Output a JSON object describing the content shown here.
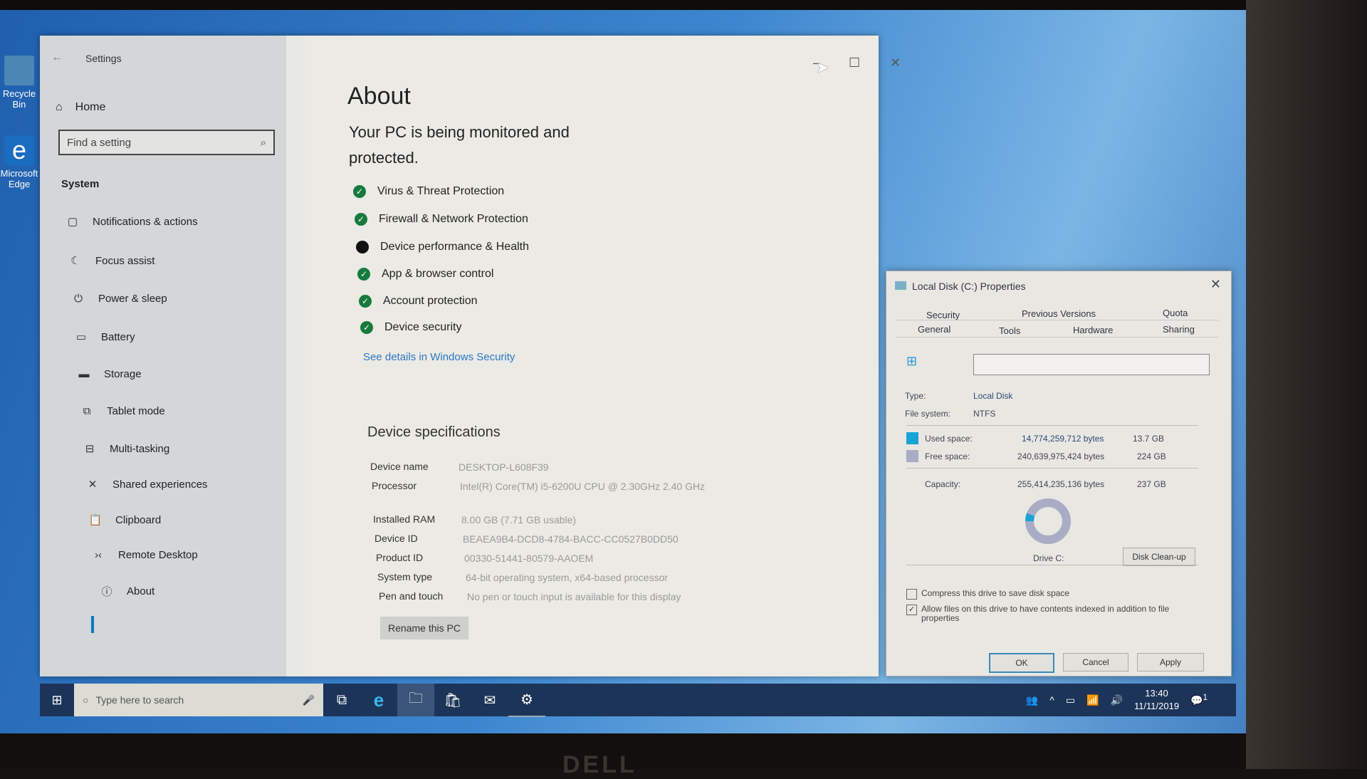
{
  "desktop": {
    "icons": [
      {
        "label": "Recycle Bin",
        "icon": "recycle-bin-icon"
      },
      {
        "label": "Microsoft Edge",
        "icon": "edge-icon"
      }
    ],
    "monitor_brand": "DELL"
  },
  "settings": {
    "window_title": "Settings",
    "back_icon": "back-arrow-icon",
    "window_controls": {
      "minimize": "–",
      "maximize": "☐",
      "close": "✕"
    },
    "home_label": "Home",
    "search_placeholder": "Find a setting",
    "section_label": "System",
    "nav_items": [
      {
        "label": "Notifications & actions",
        "icon": "notification-icon",
        "glyph": "▢"
      },
      {
        "label": "Focus assist",
        "icon": "moon-icon",
        "glyph": "☾"
      },
      {
        "label": "Power & sleep",
        "icon": "power-icon",
        "glyph": "⏻"
      },
      {
        "label": "Battery",
        "icon": "battery-icon",
        "glyph": "▭"
      },
      {
        "label": "Storage",
        "icon": "storage-icon",
        "glyph": "▬"
      },
      {
        "label": "Tablet mode",
        "icon": "tablet-icon",
        "glyph": "⧉"
      },
      {
        "label": "Multi-tasking",
        "icon": "multitasking-icon",
        "glyph": "⊟"
      },
      {
        "label": "Shared experiences",
        "icon": "shared-icon",
        "glyph": "✕"
      },
      {
        "label": "Clipboard",
        "icon": "clipboard-icon",
        "glyph": "📋"
      },
      {
        "label": "Remote Desktop",
        "icon": "remote-desktop-icon",
        "glyph": "›‹"
      },
      {
        "label": "About",
        "icon": "info-icon",
        "glyph": "ⓘ",
        "active": true
      }
    ],
    "main": {
      "title": "About",
      "subtitle": "Your PC is being monitored and protected.",
      "protection_items": [
        {
          "label": "Virus & Threat Protection",
          "status": "ok"
        },
        {
          "label": "Firewall & Network Protection",
          "status": "ok"
        },
        {
          "label": "Device performance & Health",
          "status": "attention"
        },
        {
          "label": "App & browser control",
          "status": "ok"
        },
        {
          "label": "Account protection",
          "status": "ok"
        },
        {
          "label": "Device security",
          "status": "ok"
        }
      ],
      "security_link": "See details in Windows Security",
      "specs_title": "Device specifications",
      "specs": [
        {
          "key": "Device name",
          "value": "DESKTOP-L608F39"
        },
        {
          "key": "Processor",
          "value": "Intel(R) Core(TM) i5-6200U CPU @ 2.30GHz   2.40 GHz"
        },
        {
          "key": "Installed RAM",
          "value": "8.00 GB (7.71 GB usable)"
        },
        {
          "key": "Device ID",
          "value": "BEAEA9B4-DCD8-4784-BACC-CC0527B0DD50"
        },
        {
          "key": "Product ID",
          "value": "00330-51441-80579-AAOEM"
        },
        {
          "key": "System type",
          "value": "64-bit operating system, x64-based processor"
        },
        {
          "key": "Pen and touch",
          "value": "No pen or touch input is available for this display"
        }
      ],
      "rename_button": "Rename this PC"
    }
  },
  "disk_dialog": {
    "title": "Local Disk (C:) Properties",
    "close": "✕",
    "tabs_row1": [
      "Security",
      "Previous Versions",
      "Quota"
    ],
    "tabs_row2": [
      "General",
      "Tools",
      "Hardware",
      "Sharing"
    ],
    "active_tab": "General",
    "name_value": "",
    "type_label": "Type:",
    "type_value": "Local Disk",
    "fs_label": "File system:",
    "fs_value": "NTFS",
    "used_label": "Used space:",
    "used_bytes": "14,774,259,712 bytes",
    "used_gb": "13.7 GB",
    "free_label": "Free space:",
    "free_bytes": "240,639,975,424 bytes",
    "free_gb": "224 GB",
    "capacity_label": "Capacity:",
    "capacity_bytes": "255,414,235,136 bytes",
    "capacity_gb": "237 GB",
    "used_fraction": 0.058,
    "drive_label": "Drive C:",
    "cleanup_button": "Disk Clean-up",
    "compress_label": "Compress this drive to save disk space",
    "compress_checked": false,
    "index_label": "Allow files on this drive to have contents indexed in addition to file properties",
    "index_checked": true,
    "ok": "OK",
    "cancel": "Cancel",
    "apply": "Apply",
    "colors": {
      "used": "#16a3d6",
      "free": "#a9acc4"
    }
  },
  "taskbar": {
    "search_placeholder": "Type here to search",
    "apps": [
      {
        "name": "task-view-icon",
        "glyph": "⧉"
      },
      {
        "name": "edge-icon",
        "glyph": "e"
      },
      {
        "name": "file-explorer-icon",
        "glyph": "🗀",
        "active": true
      },
      {
        "name": "store-icon",
        "glyph": "🛍"
      },
      {
        "name": "mail-icon",
        "glyph": "✉"
      },
      {
        "name": "settings-icon",
        "glyph": "⚙"
      }
    ],
    "tray": {
      "people": "👥",
      "chevron": "^",
      "battery": "▭",
      "wifi": "📶",
      "volume": "🔊"
    },
    "time": "13:40",
    "date": "11/11/2019",
    "notification_count": "1"
  }
}
